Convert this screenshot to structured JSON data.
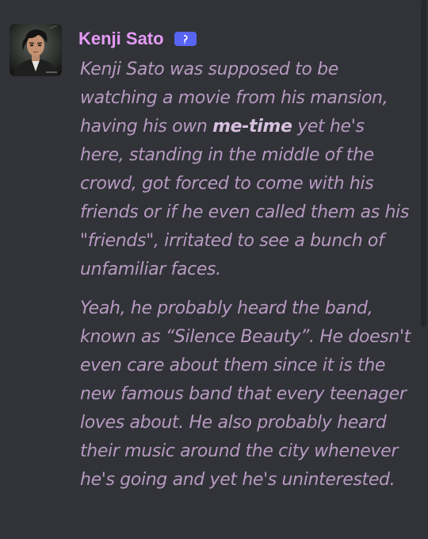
{
  "message": {
    "author": {
      "name": "Kenji Sato",
      "name_color": "#e59bf5",
      "avatar_icon": "character-portrait",
      "badge_icon": "bot-badge-icon"
    },
    "paragraph1": {
      "part1": "Kenji Sato was supposed to be watching a movie from his mansion, having his own ",
      "bold": "me-time",
      "part2": " yet he's here, standing in the middle of the crowd, got forced to come with his friends or if he even called them as his \"friends\", irritated to see a bunch of unfamiliar faces."
    },
    "paragraph2": "Yeah, he probably heard the band, known as “Silence Beauty”. He doesn't even care about them since it is the new famous band that every teenager loves about. He also probably heard their music around the city whenever he's going and yet he's uninterested.",
    "text_color": "#b79ac1"
  }
}
